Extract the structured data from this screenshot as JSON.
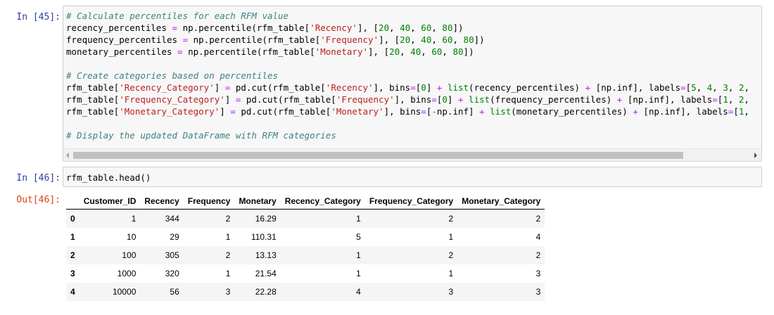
{
  "cell45": {
    "prompt": "In [45]:",
    "lines": [
      [
        {
          "t": "# Calculate percentiles for each RFM value",
          "c": "cm"
        }
      ],
      [
        {
          "t": "recency_percentiles "
        },
        {
          "t": "=",
          "c": "op"
        },
        {
          "t": " np.percentile(rfm_table["
        },
        {
          "t": "'Recency'",
          "c": "st"
        },
        {
          "t": "], ["
        },
        {
          "t": "20",
          "c": "nu"
        },
        {
          "t": ", "
        },
        {
          "t": "40",
          "c": "nu"
        },
        {
          "t": ", "
        },
        {
          "t": "60",
          "c": "nu"
        },
        {
          "t": ", "
        },
        {
          "t": "80",
          "c": "nu"
        },
        {
          "t": "])"
        }
      ],
      [
        {
          "t": "frequency_percentiles "
        },
        {
          "t": "=",
          "c": "op"
        },
        {
          "t": " np.percentile(rfm_table["
        },
        {
          "t": "'Frequency'",
          "c": "st"
        },
        {
          "t": "], ["
        },
        {
          "t": "20",
          "c": "nu"
        },
        {
          "t": ", "
        },
        {
          "t": "40",
          "c": "nu"
        },
        {
          "t": ", "
        },
        {
          "t": "60",
          "c": "nu"
        },
        {
          "t": ", "
        },
        {
          "t": "80",
          "c": "nu"
        },
        {
          "t": "])"
        }
      ],
      [
        {
          "t": "monetary_percentiles "
        },
        {
          "t": "=",
          "c": "op"
        },
        {
          "t": " np.percentile(rfm_table["
        },
        {
          "t": "'Monetary'",
          "c": "st"
        },
        {
          "t": "], ["
        },
        {
          "t": "20",
          "c": "nu"
        },
        {
          "t": ", "
        },
        {
          "t": "40",
          "c": "nu"
        },
        {
          "t": ", "
        },
        {
          "t": "60",
          "c": "nu"
        },
        {
          "t": ", "
        },
        {
          "t": "80",
          "c": "nu"
        },
        {
          "t": "])"
        }
      ],
      [],
      [
        {
          "t": "# Create categories based on percentiles",
          "c": "cm"
        }
      ],
      [
        {
          "t": "rfm_table["
        },
        {
          "t": "'Recency_Category'",
          "c": "st"
        },
        {
          "t": "] "
        },
        {
          "t": "=",
          "c": "op"
        },
        {
          "t": " pd.cut(rfm_table["
        },
        {
          "t": "'Recency'",
          "c": "st"
        },
        {
          "t": "], bins"
        },
        {
          "t": "=",
          "c": "op"
        },
        {
          "t": "["
        },
        {
          "t": "0",
          "c": "nu"
        },
        {
          "t": "] "
        },
        {
          "t": "+",
          "c": "op"
        },
        {
          "t": " "
        },
        {
          "t": "list",
          "c": "bi"
        },
        {
          "t": "(recency_percentiles) "
        },
        {
          "t": "+",
          "c": "op"
        },
        {
          "t": " [np.inf], labels"
        },
        {
          "t": "=",
          "c": "op"
        },
        {
          "t": "["
        },
        {
          "t": "5",
          "c": "nu"
        },
        {
          "t": ", "
        },
        {
          "t": "4",
          "c": "nu"
        },
        {
          "t": ", "
        },
        {
          "t": "3",
          "c": "nu"
        },
        {
          "t": ", "
        },
        {
          "t": "2",
          "c": "nu"
        },
        {
          "t": ","
        }
      ],
      [
        {
          "t": "rfm_table["
        },
        {
          "t": "'Frequency_Category'",
          "c": "st"
        },
        {
          "t": "] "
        },
        {
          "t": "=",
          "c": "op"
        },
        {
          "t": " pd.cut(rfm_table["
        },
        {
          "t": "'Frequency'",
          "c": "st"
        },
        {
          "t": "], bins"
        },
        {
          "t": "=",
          "c": "op"
        },
        {
          "t": "["
        },
        {
          "t": "0",
          "c": "nu"
        },
        {
          "t": "] "
        },
        {
          "t": "+",
          "c": "op"
        },
        {
          "t": " "
        },
        {
          "t": "list",
          "c": "bi"
        },
        {
          "t": "(frequency_percentiles) "
        },
        {
          "t": "+",
          "c": "op"
        },
        {
          "t": " [np.inf], labels"
        },
        {
          "t": "=",
          "c": "op"
        },
        {
          "t": "["
        },
        {
          "t": "1",
          "c": "nu"
        },
        {
          "t": ", "
        },
        {
          "t": "2",
          "c": "nu"
        },
        {
          "t": ","
        }
      ],
      [
        {
          "t": "rfm_table["
        },
        {
          "t": "'Monetary_Category'",
          "c": "st"
        },
        {
          "t": "] "
        },
        {
          "t": "=",
          "c": "op"
        },
        {
          "t": " pd.cut(rfm_table["
        },
        {
          "t": "'Monetary'",
          "c": "st"
        },
        {
          "t": "], bins"
        },
        {
          "t": "=",
          "c": "op"
        },
        {
          "t": "["
        },
        {
          "t": "-",
          "c": "op"
        },
        {
          "t": "np.inf] "
        },
        {
          "t": "+",
          "c": "op"
        },
        {
          "t": " "
        },
        {
          "t": "list",
          "c": "bi"
        },
        {
          "t": "(monetary_percentiles) "
        },
        {
          "t": "+",
          "c": "op"
        },
        {
          "t": " [np.inf], labels"
        },
        {
          "t": "=",
          "c": "op"
        },
        {
          "t": "["
        },
        {
          "t": "1",
          "c": "nu"
        },
        {
          "t": ","
        }
      ],
      [],
      [
        {
          "t": "# Display the updated DataFrame with RFM categories",
          "c": "cm"
        }
      ]
    ]
  },
  "cell46": {
    "prompt": "In [46]:",
    "code": "rfm_table.head()",
    "out_prompt": "Out[46]:"
  },
  "table": {
    "columns": [
      "",
      "Customer_ID",
      "Recency",
      "Frequency",
      "Monetary",
      "Recency_Category",
      "Frequency_Category",
      "Monetary_Category"
    ],
    "rows": [
      [
        "0",
        "1",
        "344",
        "2",
        "16.29",
        "1",
        "2",
        "2"
      ],
      [
        "1",
        "10",
        "29",
        "1",
        "110.31",
        "5",
        "1",
        "4"
      ],
      [
        "2",
        "100",
        "305",
        "2",
        "13.13",
        "1",
        "2",
        "2"
      ],
      [
        "3",
        "1000",
        "320",
        "1",
        "21.54",
        "1",
        "1",
        "3"
      ],
      [
        "4",
        "10000",
        "56",
        "3",
        "22.28",
        "4",
        "3",
        "3"
      ]
    ]
  }
}
